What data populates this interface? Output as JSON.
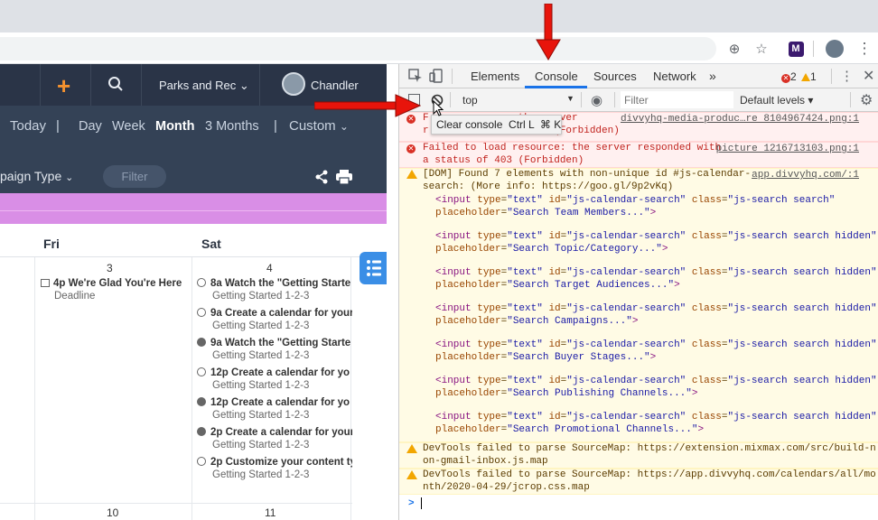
{
  "browser": {
    "toolbar_icons": [
      "zoom-icon",
      "star-icon",
      "extension-icon",
      "profile-avatar",
      "menu-icon"
    ]
  },
  "app": {
    "nav": {
      "workspace": "Parks and Rec",
      "user": "Chandler"
    },
    "views": {
      "today": "Today",
      "sep1": "|",
      "day": "Day",
      "week": "Week",
      "month": "Month",
      "three_months": "3 Months",
      "sep2": "|",
      "custom": "Custom"
    },
    "filters": {
      "campaign_type": "paign Type",
      "filter": "Filter"
    },
    "calendar": {
      "days": [
        "Fri",
        "Sat"
      ],
      "week1": {
        "fri_date": "3",
        "sat_date": "4",
        "fri_event": {
          "time": "4p",
          "title": "We're Glad You're Here",
          "sub": "Deadline"
        },
        "sat_events": [
          {
            "time": "8a",
            "title": "Watch the \"Getting Starte",
            "sub": "Getting Started 1-2-3",
            "done": false
          },
          {
            "time": "9a",
            "title": "Create a calendar for your",
            "sub": "Getting Started 1-2-3",
            "done": false
          },
          {
            "time": "9a",
            "title": "Watch the \"Getting Starte",
            "sub": "Getting Started 1-2-3",
            "done": true
          },
          {
            "time": "12p",
            "title": "Create a calendar for yo",
            "sub": "Getting Started 1-2-3",
            "done": false
          },
          {
            "time": "12p",
            "title": "Create a calendar for yo",
            "sub": "Getting Started 1-2-3",
            "done": true
          },
          {
            "time": "2p",
            "title": "Create a calendar for your",
            "sub": "Getting Started 1-2-3",
            "done": true
          },
          {
            "time": "2p",
            "title": "Customize your content ty",
            "sub": "Getting Started 1-2-3",
            "done": false
          }
        ]
      },
      "week2": {
        "fri_date": "10",
        "sat_date": "11"
      }
    },
    "colors": {
      "nav_bg": "#2a3447",
      "subbar_bg": "#344256",
      "purple": "#d98ee6",
      "accent_orange": "#f5922f"
    }
  },
  "devtools": {
    "tabs": [
      "Elements",
      "Console",
      "Sources",
      "Network"
    ],
    "more": "»",
    "active_tab": "Console",
    "error_count": "2",
    "warning_count": "1",
    "context": "top",
    "filter_placeholder": "Filter",
    "levels": "Default levels ▾",
    "tooltip": "Clear console  Ctrl L  ⌘ K",
    "messages": [
      {
        "level": "error",
        "lines": [
          "F               the server ",
          "r               f 403 (Forbidden)"
        ],
        "source": "divvyhq-media-produc…re 8104967424.png:1"
      },
      {
        "level": "error",
        "lines": [
          "Failed to load resource: the server responded with ",
          "a status of 403 (Forbidden)"
        ],
        "source": "picture 1216713103.png:1"
      },
      {
        "level": "warn",
        "lines": [
          "[DOM] Found 7 elements with non-unique id #js-calendar-",
          "search: (More info: https://goo.gl/9p2vKq)"
        ],
        "source": "app.divvyhq.com/:1"
      },
      {
        "level": "warn",
        "source": "",
        "lines": [
          "DevTools failed to parse SourceMap: https://extension.mixmax.com/src/build-n",
          "on-gmail-inbox.js.map"
        ]
      },
      {
        "level": "warn",
        "source": "",
        "lines": [
          "DevTools failed to parse SourceMap: https://app.divvyhq.com/calendars/all/mo",
          "nth/2020-04-29/jcrop.css.map"
        ]
      }
    ],
    "elements": [
      {
        "class": "js-search search",
        "placeholder": "Search Team Members..."
      },
      {
        "class": "js-search search hidden",
        "placeholder": "Search Topic/Category..."
      },
      {
        "class": "js-search search hidden",
        "placeholder": "Search Target Audiences..."
      },
      {
        "class": "js-search search hidden",
        "placeholder": "Search Campaigns..."
      },
      {
        "class": "js-search search hidden",
        "placeholder": "Search Buyer Stages..."
      },
      {
        "class": "js-search search hidden",
        "placeholder": "Search Publishing Channels..."
      },
      {
        "class": "js-search search hidden",
        "placeholder": "Search Promotional Channels..."
      }
    ],
    "prompt": ">"
  }
}
